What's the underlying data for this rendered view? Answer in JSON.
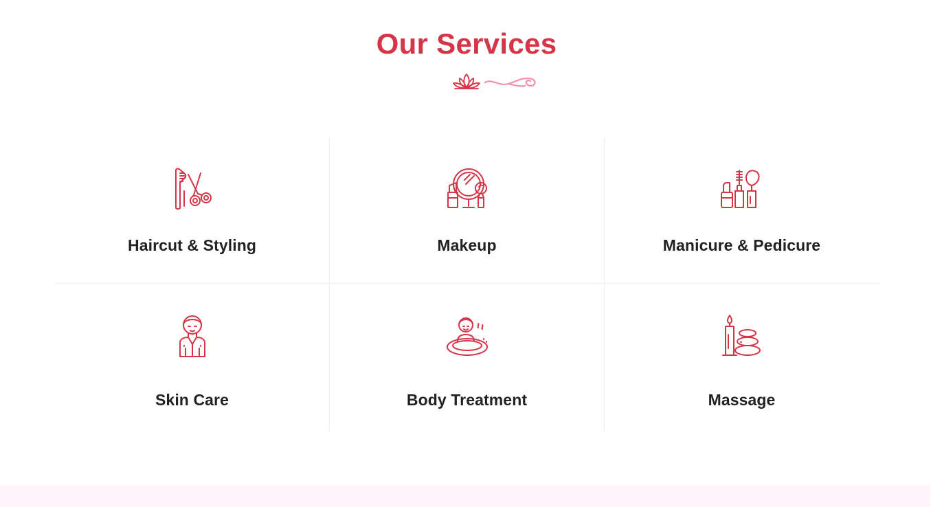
{
  "section": {
    "title": "Our Services"
  },
  "colors": {
    "accent": "#d63447",
    "ornament_pink": "#f48fb1",
    "label_text": "#222222",
    "divider": "#eeeeee",
    "next_section_bg": "#fff5fb"
  },
  "services": [
    {
      "label": "Haircut & Styling",
      "icon": "comb-scissors-icon"
    },
    {
      "label": "Makeup",
      "icon": "mirror-lipstick-brush-icon"
    },
    {
      "label": "Manicure & Pedicure",
      "icon": "nail-polish-mascara-brush-icon"
    },
    {
      "label": "Skin Care",
      "icon": "face-mask-woman-icon"
    },
    {
      "label": "Body Treatment",
      "icon": "spa-bath-woman-icon"
    },
    {
      "label": "Massage",
      "icon": "candle-hot-stones-icon"
    }
  ]
}
